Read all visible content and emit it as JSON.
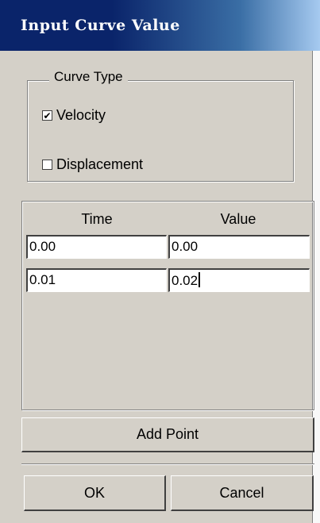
{
  "window": {
    "title": "Input Curve Value"
  },
  "curve_type": {
    "legend": "Curve Type",
    "options": [
      {
        "label": "Velocity",
        "checked": true
      },
      {
        "label": "Displacement",
        "checked": false
      }
    ]
  },
  "table": {
    "headers": [
      "Time",
      "Value"
    ],
    "rows": [
      {
        "time": "0.00",
        "value": "0.00"
      },
      {
        "time": "0.01",
        "value": "0.02"
      }
    ]
  },
  "buttons": {
    "add_point": "Add Point",
    "ok": "OK",
    "cancel": "Cancel"
  },
  "colors": {
    "title_bar": "#0a246a",
    "face": "#d4d0c8"
  }
}
